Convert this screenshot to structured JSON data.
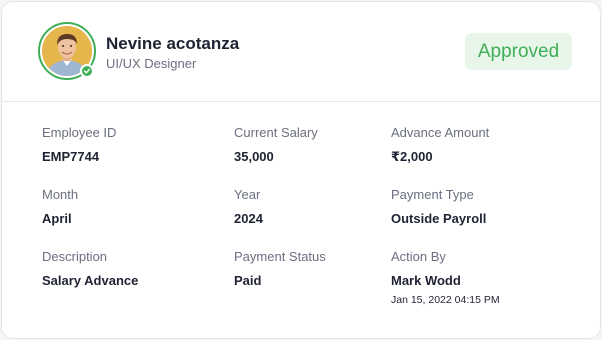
{
  "profile": {
    "name": "Nevine acotanza",
    "role": "UI/UX Designer",
    "status": "Approved",
    "avatar_icon": "person-avatar",
    "verified_icon": "check-icon"
  },
  "fields": {
    "employee_id": {
      "label": "Employee ID",
      "value": "EMP7744"
    },
    "current_salary": {
      "label": "Current Salary",
      "value": "35,000"
    },
    "advance_amount": {
      "label": "Advance Amount",
      "value": "₹2,000"
    },
    "month": {
      "label": "Month",
      "value": "April"
    },
    "year": {
      "label": "Year",
      "value": "2024"
    },
    "payment_type": {
      "label": "Payment Type",
      "value": "Outside Payroll"
    },
    "description": {
      "label": "Description",
      "value": "Salary Advance"
    },
    "payment_status": {
      "label": "Payment Status",
      "value": "Paid"
    },
    "action_by": {
      "label": "Action By",
      "value": "Mark Wodd",
      "timestamp": "Jan 15, 2022 04:15 PM"
    }
  },
  "colors": {
    "accent_green": "#3fae56",
    "badge_bg": "#e8f6ea",
    "text_primary": "#1f2333",
    "text_muted": "#6b6f80",
    "border": "#e6e7ec"
  }
}
